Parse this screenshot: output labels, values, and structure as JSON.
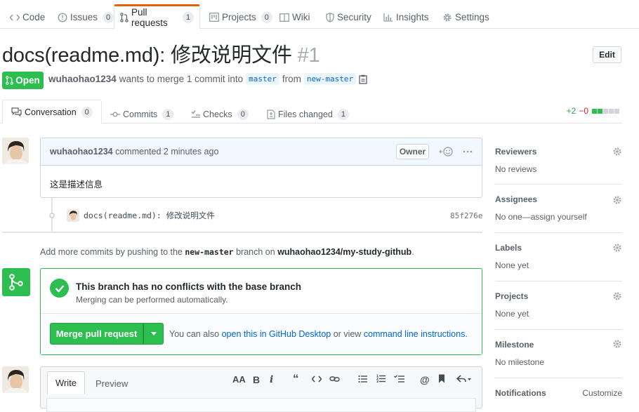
{
  "repo_tabs": {
    "code": "Code",
    "issues": "Issues",
    "issues_count": "0",
    "pulls": "Pull requests",
    "pulls_count": "1",
    "projects": "Projects",
    "projects_count": "0",
    "wiki": "Wiki",
    "security": "Security",
    "insights": "Insights",
    "settings": "Settings"
  },
  "pr": {
    "title": "docs(readme.md): 修改说明文件",
    "number": "#1",
    "edit_label": "Edit",
    "state": "Open",
    "author": "wuhaohao1234",
    "merge_text": "wants to merge 1 commit into",
    "base_branch": "master",
    "from_text": "from",
    "head_branch": "new-master"
  },
  "pr_tabs": {
    "conversation": "Conversation",
    "conversation_count": "0",
    "commits": "Commits",
    "commits_count": "1",
    "checks": "Checks",
    "checks_count": "0",
    "files": "Files changed",
    "files_count": "1"
  },
  "diffstat": {
    "additions": "+2",
    "deletions": "−0",
    "blocks": [
      "green",
      "green",
      "gray",
      "gray",
      "gray"
    ],
    "green": "#2cbe4e",
    "gray": "#d1d5da"
  },
  "comment": {
    "author": "wuhaohao1234",
    "action": "commented 2 minutes ago",
    "role": "Owner",
    "body": "这是描述信息"
  },
  "commit": {
    "message": "docs(readme.md): 修改说明文件",
    "sha": "85f276e"
  },
  "hint": {
    "prefix": "Add more commits by pushing to the",
    "branch": "new-master",
    "middle": "branch on",
    "repo": "wuhaohao1234/my-study-github",
    "suffix": "."
  },
  "merge": {
    "title": "This branch has no conflicts with the base branch",
    "subtitle": "Merging can be performed automatically.",
    "button": "Merge pull request",
    "also_prefix": "You can also",
    "desktop_link": "open this in GitHub Desktop",
    "or_view": "or view",
    "cli_link": "command line instructions",
    "suffix": "."
  },
  "editor": {
    "write": "Write",
    "preview": "Preview"
  },
  "sidebar": {
    "reviewers": {
      "title": "Reviewers",
      "value": "No reviews"
    },
    "assignees": {
      "title": "Assignees",
      "value": "No one—assign yourself"
    },
    "labels": {
      "title": "Labels",
      "value": "None yet"
    },
    "projects": {
      "title": "Projects",
      "value": "None yet"
    },
    "milestone": {
      "title": "Milestone",
      "value": "No milestone"
    },
    "notifications": {
      "title": "Notifications",
      "action": "Customize"
    }
  },
  "colors": {
    "accent_orange": "#e36209",
    "green": "#2cbe4e",
    "link": "#0366d6"
  }
}
